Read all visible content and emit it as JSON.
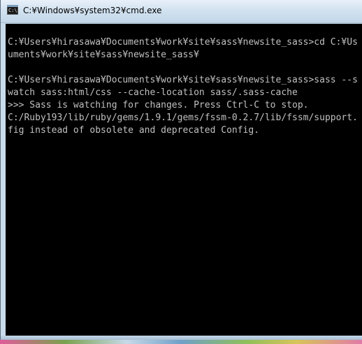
{
  "window": {
    "title": "C:¥Windows¥system32¥cmd.exe",
    "icon": "cmd-icon",
    "icon_text": "C:\\"
  },
  "console": {
    "text_color": "#c0c0c0",
    "background_color": "#000000",
    "lines": [
      "C:¥Users¥hirasawa¥Documents¥work¥site¥sass¥newsite_sass>cd C:¥Us",
      "uments¥work¥site¥sass¥newsite_sass¥",
      "",
      "C:¥Users¥hirasawa¥Documents¥work¥site¥sass¥newsite_sass>sass --s",
      "watch sass:html/css --cache-location sass/.sass-cache",
      ">>> Sass is watching for changes. Press Ctrl-C to stop.",
      "C:/Ruby193/lib/ruby/gems/1.9.1/gems/fssm-0.2.7/lib/fssm/support.",
      "fig instead of obsolete and deprecated Config."
    ]
  }
}
